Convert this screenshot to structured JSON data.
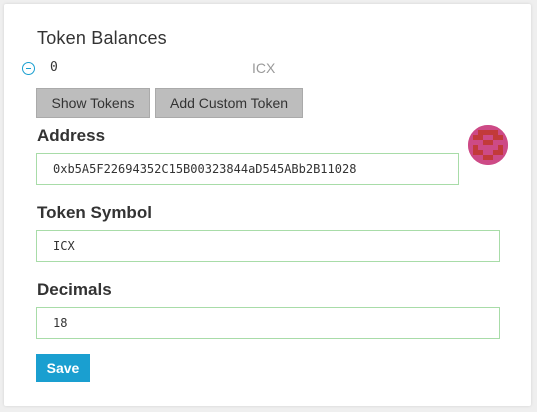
{
  "token_balances": {
    "title": "Token Balances",
    "items": [
      {
        "value": "0",
        "symbol": "ICX"
      }
    ]
  },
  "buttons": {
    "show_tokens": "Show Tokens",
    "add_custom_token": "Add Custom Token",
    "save": "Save"
  },
  "form": {
    "address": {
      "label": "Address",
      "value": "0xb5A5F22694352C15B00323844aD545ABb2B11028"
    },
    "token_symbol": {
      "label": "Token Symbol",
      "value": "ICX"
    },
    "decimals": {
      "label": "Decimals",
      "value": "18"
    }
  },
  "colors": {
    "accent": "#1a9fd0",
    "input_border": "#a8dca8",
    "gray_button": "#bdbdbd",
    "avatar_primary": "#cd4a86",
    "avatar_secondary": "#c23a3a"
  },
  "icons": {
    "remove_token": "minus-circle-icon",
    "identicon": "identicon-avatar"
  }
}
